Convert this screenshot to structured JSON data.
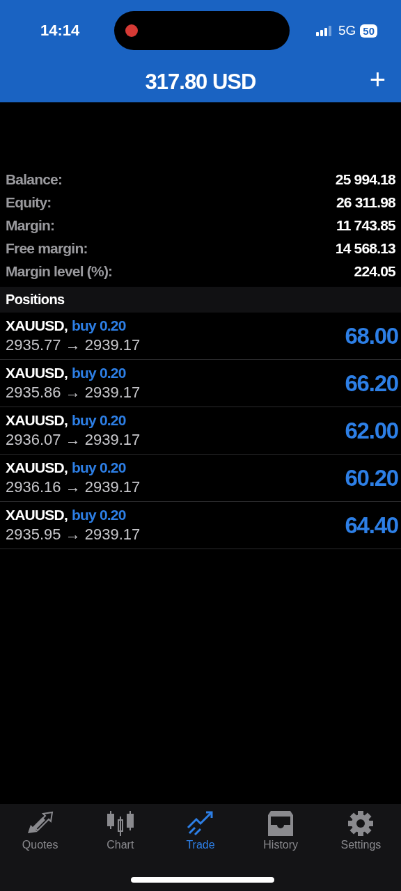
{
  "status_bar": {
    "time": "14:14",
    "network": "5G",
    "battery": "50"
  },
  "header": {
    "title": "317.80 USD",
    "add_label": "+"
  },
  "summary": [
    {
      "label": "Balance:",
      "value": "25 994.18"
    },
    {
      "label": "Equity:",
      "value": "26 311.98"
    },
    {
      "label": "Margin:",
      "value": "11 743.85"
    },
    {
      "label": "Free margin:",
      "value": "14 568.13"
    },
    {
      "label": "Margin level (%):",
      "value": "224.05"
    }
  ],
  "positions_title": "Positions",
  "positions": [
    {
      "symbol": "XAUUSD,",
      "side": "buy 0.20",
      "prices": "2935.77 → 2939.17",
      "profit": "68.00"
    },
    {
      "symbol": "XAUUSD,",
      "side": "buy 0.20",
      "prices": "2935.86 → 2939.17",
      "profit": "66.20"
    },
    {
      "symbol": "XAUUSD,",
      "side": "buy 0.20",
      "prices": "2936.07 → 2939.17",
      "profit": "62.00"
    },
    {
      "symbol": "XAUUSD,",
      "side": "buy 0.20",
      "prices": "2936.16 → 2939.17",
      "profit": "60.20"
    },
    {
      "symbol": "XAUUSD,",
      "side": "buy 0.20",
      "prices": "2935.95 → 2939.17",
      "profit": "64.40"
    }
  ],
  "tabs": [
    {
      "label": "Quotes",
      "kind": "quotes",
      "selected": false
    },
    {
      "label": "Chart",
      "kind": "chart",
      "selected": false
    },
    {
      "label": "Trade",
      "kind": "trade",
      "selected": true
    },
    {
      "label": "History",
      "kind": "history",
      "selected": false
    },
    {
      "label": "Settings",
      "kind": "settings",
      "selected": false
    }
  ]
}
